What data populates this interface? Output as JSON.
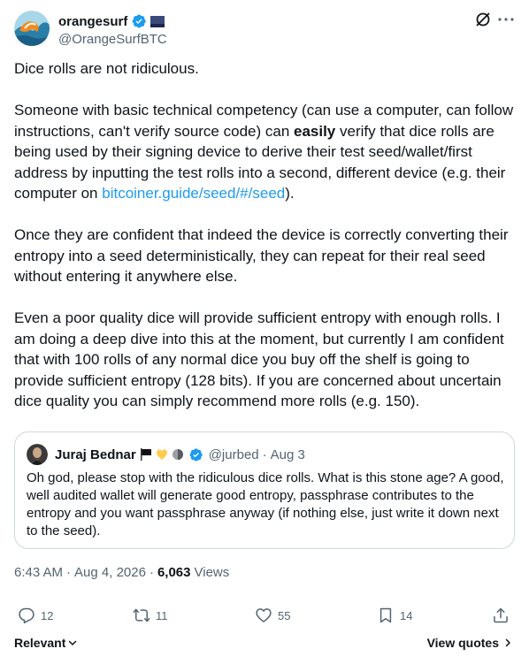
{
  "post": {
    "author": {
      "display_name": "orangesurf",
      "handle": "@OrangeSurfBTC",
      "verified": true,
      "avatar_icon": "wave-avatar",
      "flag_icon": "navy-blue-flag"
    },
    "paragraphs": [
      {
        "segments": [
          {
            "text": "Dice rolls are not ridiculous."
          }
        ]
      },
      {
        "segments": [
          {
            "text": "Someone with basic technical competency (can use a computer, can follow instructions, can't verify source code) can "
          },
          {
            "text": "easily",
            "bold": true
          },
          {
            "text": " verify that dice rolls are being used by their signing device to derive their test seed/wallet/first address by inputting the  test rolls into a second, different device (e.g. their computer on "
          },
          {
            "text": "bitcoiner.guide/seed/#/seed",
            "link": true
          },
          {
            "text": ")."
          }
        ]
      },
      {
        "segments": [
          {
            "text": "Once they are confident that indeed the device is correctly converting their entropy into a seed deterministically, they can repeat for their real seed without entering it anywhere else."
          }
        ]
      },
      {
        "segments": [
          {
            "text": "Even a poor quality dice will provide sufficient entropy with enough rolls. I am doing a deep dive into this at the moment, but currently I am confident that with 100 rolls of any normal dice you buy off the shelf is going to provide sufficient entropy (128 bits). If you are concerned about uncertain dice quality you can simply recommend more rolls (e.g. 150)."
          }
        ]
      }
    ],
    "quote": {
      "display_name": "Juraj Bednar",
      "emoji_icons": [
        "black-flag-icon",
        "yellow-heart-icon",
        "gray-circle-icon"
      ],
      "verified": true,
      "handle": "@jurbed",
      "separator": "·",
      "date": "Aug 3",
      "text": "Oh god, please stop with the ridiculous dice rolls. What is this stone age? A good, well audited wallet will generate good entropy, passphrase contributes to the entropy and you want passphrase anyway (if nothing else, just write it down next to the seed)."
    },
    "meta": {
      "time": "6:43 AM",
      "separator": "·",
      "date": "Aug 4, 2026",
      "separator2": "·",
      "views_count": "6,063",
      "views_label": "Views"
    },
    "actions": {
      "replies": "12",
      "reposts": "11",
      "likes": "55",
      "bookmarks": "14"
    },
    "footer": {
      "sort_label": "Relevant",
      "view_quotes_label": "View quotes"
    }
  },
  "colors": {
    "link": "#1d9bf0",
    "verified": "#1d9bf0",
    "secondary_text": "#536471",
    "border": "#cfd9de"
  }
}
